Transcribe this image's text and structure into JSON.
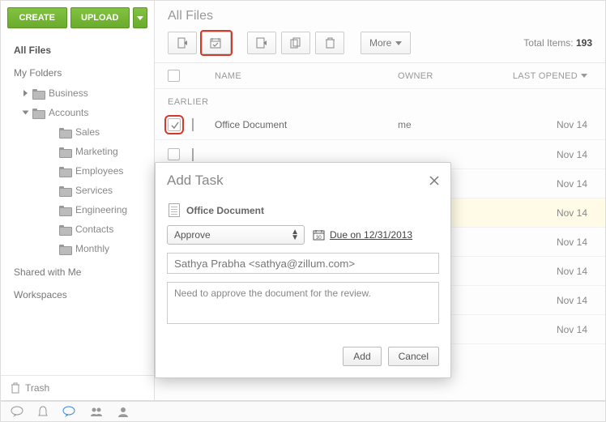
{
  "sidebar": {
    "create_label": "CREATE",
    "upload_label": "UPLOAD",
    "all_files": "All Files",
    "my_folders": "My Folders",
    "folders_l1": [
      "Business",
      "Accounts"
    ],
    "folders_l2": [
      "Sales",
      "Marketing",
      "Employees",
      "Services",
      "Engineering",
      "Contacts",
      "Monthly"
    ],
    "shared": "Shared with Me",
    "workspaces": "Workspaces",
    "trash": "Trash"
  },
  "header": {
    "breadcrumb": "All Files",
    "more_label": "More",
    "total_label": "Total Items: ",
    "total_count": "193"
  },
  "columns": {
    "name": "NAME",
    "owner": "OWNER",
    "last_opened": "LAST OPENED"
  },
  "group_label": "EARLIER",
  "rows": [
    {
      "name": "Office Document",
      "owner": "me",
      "date": "Nov 14",
      "checked": true,
      "highlight": false
    },
    {
      "name": "",
      "owner": "",
      "date": "Nov 14",
      "checked": false,
      "highlight": false
    },
    {
      "name": "",
      "owner": "",
      "date": "Nov 14",
      "checked": false,
      "highlight": false
    },
    {
      "name": "",
      "owner": "",
      "date": "Nov 14",
      "checked": false,
      "highlight": true
    },
    {
      "name": "",
      "owner": "",
      "date": "Nov 14",
      "checked": false,
      "highlight": false
    },
    {
      "name": "",
      "owner": "",
      "date": "Nov 14",
      "checked": false,
      "highlight": false
    },
    {
      "name": "",
      "owner": "",
      "date": "Nov 14",
      "checked": false,
      "highlight": false
    },
    {
      "name": "",
      "owner": "",
      "date": "Nov 14",
      "checked": false,
      "highlight": false
    }
  ],
  "modal": {
    "title": "Add Task",
    "file_name": "Office Document",
    "action_selected": "Approve",
    "due_label": "Due on 12/31/2013",
    "assignee": "Sathya Prabha <sathya@zillum.com>",
    "description": "Need to approve the document for the review.",
    "add_label": "Add",
    "cancel_label": "Cancel"
  }
}
